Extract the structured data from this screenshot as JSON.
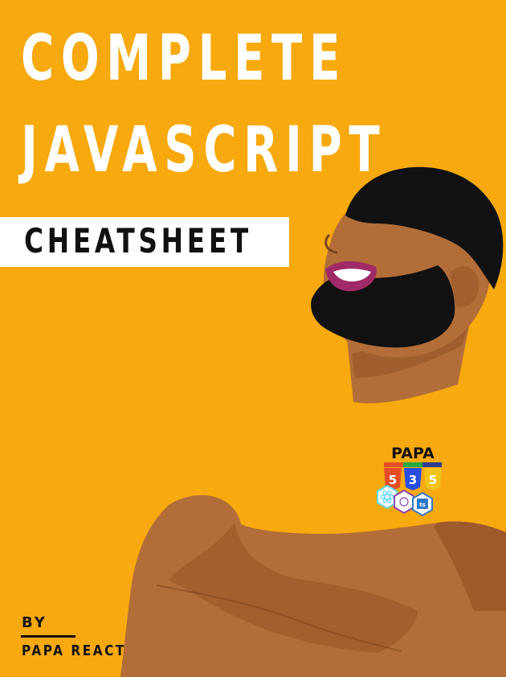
{
  "cover": {
    "title_line1": "COMPLETE",
    "title_line2": "JAVASCRIPT",
    "subtitle": "CHEATSHEET",
    "by_label": "BY",
    "author": "PAPA REACT"
  },
  "badge": {
    "label": "PAPA",
    "tiles": [
      "5",
      "3",
      "5"
    ],
    "logos": [
      "react-logo",
      "webpack-logo",
      "ts"
    ]
  },
  "colors": {
    "background": "#f7a90d",
    "skin": "#b36d38",
    "skin_shadow": "#8f5228",
    "hair": "#111111",
    "mouth": "#a02a67"
  }
}
